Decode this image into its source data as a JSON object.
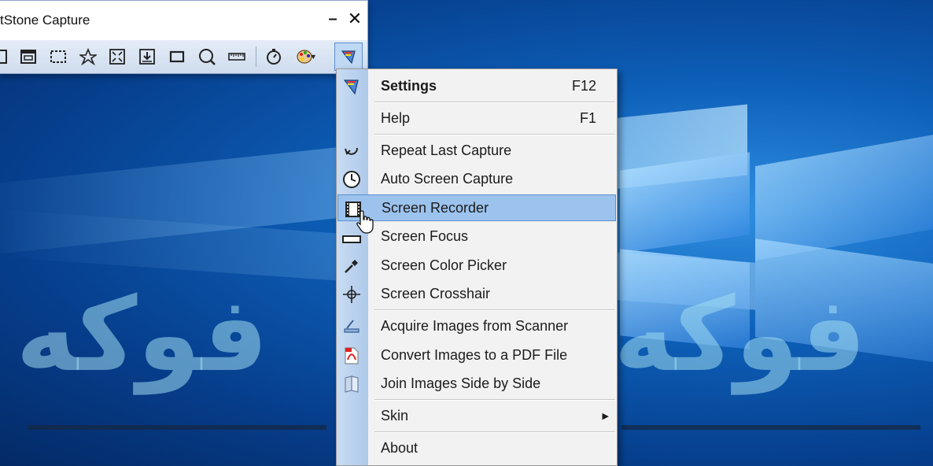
{
  "window": {
    "title": "tStone Capture",
    "minimize_glyph": "–",
    "close_glyph": "✕"
  },
  "toolbar": {
    "tools": [
      {
        "name": "capture-window-icon"
      },
      {
        "name": "capture-active-window-icon"
      },
      {
        "name": "capture-rectangle-icon"
      },
      {
        "name": "capture-freehand-icon"
      },
      {
        "name": "capture-fullscreen-icon"
      },
      {
        "name": "capture-scrolling-icon"
      },
      {
        "name": "capture-fixed-region-icon"
      },
      {
        "name": "magnifier-icon"
      },
      {
        "name": "ruler-icon"
      },
      {
        "name": "delay-timer-icon"
      },
      {
        "name": "output-palette-icon"
      },
      {
        "name": "settings-menu-icon"
      }
    ]
  },
  "menu": {
    "items": [
      {
        "label": "Settings",
        "shortcut": "F12",
        "icon": "settings-icon",
        "bold": true
      },
      {
        "label": "Help",
        "shortcut": "F1"
      },
      {
        "label": "Repeat Last Capture",
        "icon": "repeat-icon"
      },
      {
        "label": "Auto Screen Capture",
        "icon": "clock-icon"
      },
      {
        "label": "Screen Recorder",
        "icon": "film-icon",
        "highlighted": true
      },
      {
        "label": "Screen Focus",
        "icon": "focus-icon"
      },
      {
        "label": "Screen Color Picker",
        "icon": "eyedropper-icon"
      },
      {
        "label": "Screen Crosshair",
        "icon": "crosshair-icon"
      },
      {
        "label": "Acquire Images from Scanner",
        "icon": "scanner-icon"
      },
      {
        "label": "Convert Images to a PDF File",
        "icon": "pdf-icon"
      },
      {
        "label": "Join Images Side by Side",
        "icon": "join-icon"
      },
      {
        "label": "Skin",
        "submenu_arrow": "▶"
      },
      {
        "label": "About"
      }
    ]
  },
  "watermark": {
    "text": "فوكه"
  },
  "colors": {
    "menu_highlight": "#9cc3ee",
    "menu_gutter": "#bcd3ef",
    "desktop_blue": "#0d5fb8"
  }
}
